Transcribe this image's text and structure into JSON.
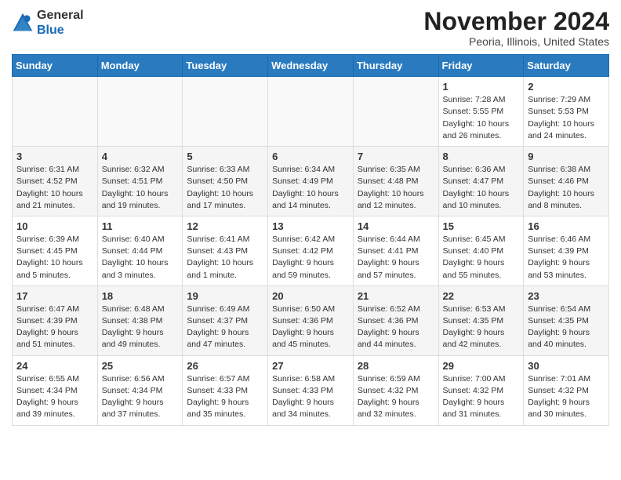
{
  "logo": {
    "general": "General",
    "blue": "Blue"
  },
  "title": "November 2024",
  "location": "Peoria, Illinois, United States",
  "weekdays": [
    "Sunday",
    "Monday",
    "Tuesday",
    "Wednesday",
    "Thursday",
    "Friday",
    "Saturday"
  ],
  "weeks": [
    [
      {
        "day": "",
        "info": ""
      },
      {
        "day": "",
        "info": ""
      },
      {
        "day": "",
        "info": ""
      },
      {
        "day": "",
        "info": ""
      },
      {
        "day": "",
        "info": ""
      },
      {
        "day": "1",
        "info": "Sunrise: 7:28 AM\nSunset: 5:55 PM\nDaylight: 10 hours and 26 minutes."
      },
      {
        "day": "2",
        "info": "Sunrise: 7:29 AM\nSunset: 5:53 PM\nDaylight: 10 hours and 24 minutes."
      }
    ],
    [
      {
        "day": "3",
        "info": "Sunrise: 6:31 AM\nSunset: 4:52 PM\nDaylight: 10 hours and 21 minutes."
      },
      {
        "day": "4",
        "info": "Sunrise: 6:32 AM\nSunset: 4:51 PM\nDaylight: 10 hours and 19 minutes."
      },
      {
        "day": "5",
        "info": "Sunrise: 6:33 AM\nSunset: 4:50 PM\nDaylight: 10 hours and 17 minutes."
      },
      {
        "day": "6",
        "info": "Sunrise: 6:34 AM\nSunset: 4:49 PM\nDaylight: 10 hours and 14 minutes."
      },
      {
        "day": "7",
        "info": "Sunrise: 6:35 AM\nSunset: 4:48 PM\nDaylight: 10 hours and 12 minutes."
      },
      {
        "day": "8",
        "info": "Sunrise: 6:36 AM\nSunset: 4:47 PM\nDaylight: 10 hours and 10 minutes."
      },
      {
        "day": "9",
        "info": "Sunrise: 6:38 AM\nSunset: 4:46 PM\nDaylight: 10 hours and 8 minutes."
      }
    ],
    [
      {
        "day": "10",
        "info": "Sunrise: 6:39 AM\nSunset: 4:45 PM\nDaylight: 10 hours and 5 minutes."
      },
      {
        "day": "11",
        "info": "Sunrise: 6:40 AM\nSunset: 4:44 PM\nDaylight: 10 hours and 3 minutes."
      },
      {
        "day": "12",
        "info": "Sunrise: 6:41 AM\nSunset: 4:43 PM\nDaylight: 10 hours and 1 minute."
      },
      {
        "day": "13",
        "info": "Sunrise: 6:42 AM\nSunset: 4:42 PM\nDaylight: 9 hours and 59 minutes."
      },
      {
        "day": "14",
        "info": "Sunrise: 6:44 AM\nSunset: 4:41 PM\nDaylight: 9 hours and 57 minutes."
      },
      {
        "day": "15",
        "info": "Sunrise: 6:45 AM\nSunset: 4:40 PM\nDaylight: 9 hours and 55 minutes."
      },
      {
        "day": "16",
        "info": "Sunrise: 6:46 AM\nSunset: 4:39 PM\nDaylight: 9 hours and 53 minutes."
      }
    ],
    [
      {
        "day": "17",
        "info": "Sunrise: 6:47 AM\nSunset: 4:39 PM\nDaylight: 9 hours and 51 minutes."
      },
      {
        "day": "18",
        "info": "Sunrise: 6:48 AM\nSunset: 4:38 PM\nDaylight: 9 hours and 49 minutes."
      },
      {
        "day": "19",
        "info": "Sunrise: 6:49 AM\nSunset: 4:37 PM\nDaylight: 9 hours and 47 minutes."
      },
      {
        "day": "20",
        "info": "Sunrise: 6:50 AM\nSunset: 4:36 PM\nDaylight: 9 hours and 45 minutes."
      },
      {
        "day": "21",
        "info": "Sunrise: 6:52 AM\nSunset: 4:36 PM\nDaylight: 9 hours and 44 minutes."
      },
      {
        "day": "22",
        "info": "Sunrise: 6:53 AM\nSunset: 4:35 PM\nDaylight: 9 hours and 42 minutes."
      },
      {
        "day": "23",
        "info": "Sunrise: 6:54 AM\nSunset: 4:35 PM\nDaylight: 9 hours and 40 minutes."
      }
    ],
    [
      {
        "day": "24",
        "info": "Sunrise: 6:55 AM\nSunset: 4:34 PM\nDaylight: 9 hours and 39 minutes."
      },
      {
        "day": "25",
        "info": "Sunrise: 6:56 AM\nSunset: 4:34 PM\nDaylight: 9 hours and 37 minutes."
      },
      {
        "day": "26",
        "info": "Sunrise: 6:57 AM\nSunset: 4:33 PM\nDaylight: 9 hours and 35 minutes."
      },
      {
        "day": "27",
        "info": "Sunrise: 6:58 AM\nSunset: 4:33 PM\nDaylight: 9 hours and 34 minutes."
      },
      {
        "day": "28",
        "info": "Sunrise: 6:59 AM\nSunset: 4:32 PM\nDaylight: 9 hours and 32 minutes."
      },
      {
        "day": "29",
        "info": "Sunrise: 7:00 AM\nSunset: 4:32 PM\nDaylight: 9 hours and 31 minutes."
      },
      {
        "day": "30",
        "info": "Sunrise: 7:01 AM\nSunset: 4:32 PM\nDaylight: 9 hours and 30 minutes."
      }
    ]
  ]
}
